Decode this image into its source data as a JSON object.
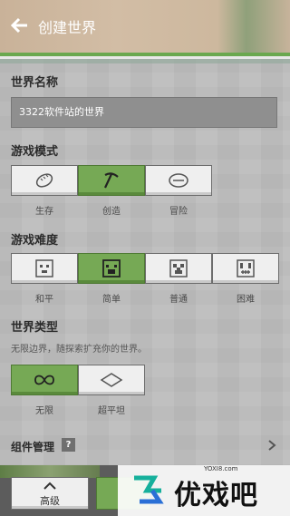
{
  "header": {
    "title": "创建世界"
  },
  "world_name": {
    "label": "世界名称",
    "value": "3322软件站的世界"
  },
  "game_mode": {
    "label": "游戏模式",
    "options": [
      "生存",
      "创造",
      "冒险"
    ],
    "selected": "创造"
  },
  "difficulty": {
    "label": "游戏难度",
    "options": [
      "和平",
      "简单",
      "普通",
      "困难"
    ],
    "selected": "简单"
  },
  "world_type": {
    "label": "世界类型",
    "description": "无限边界，随探索扩充你的世界。",
    "options": [
      "无限",
      "超平坦"
    ],
    "selected": "无限"
  },
  "components": {
    "label": "组件管理",
    "help": "?"
  },
  "bottom": {
    "advanced_label": "高级"
  },
  "watermark": {
    "text": "优戏吧",
    "url": "YOXI8.com"
  },
  "colors": {
    "accent": "#76a955",
    "field": "#8f8f8f"
  }
}
